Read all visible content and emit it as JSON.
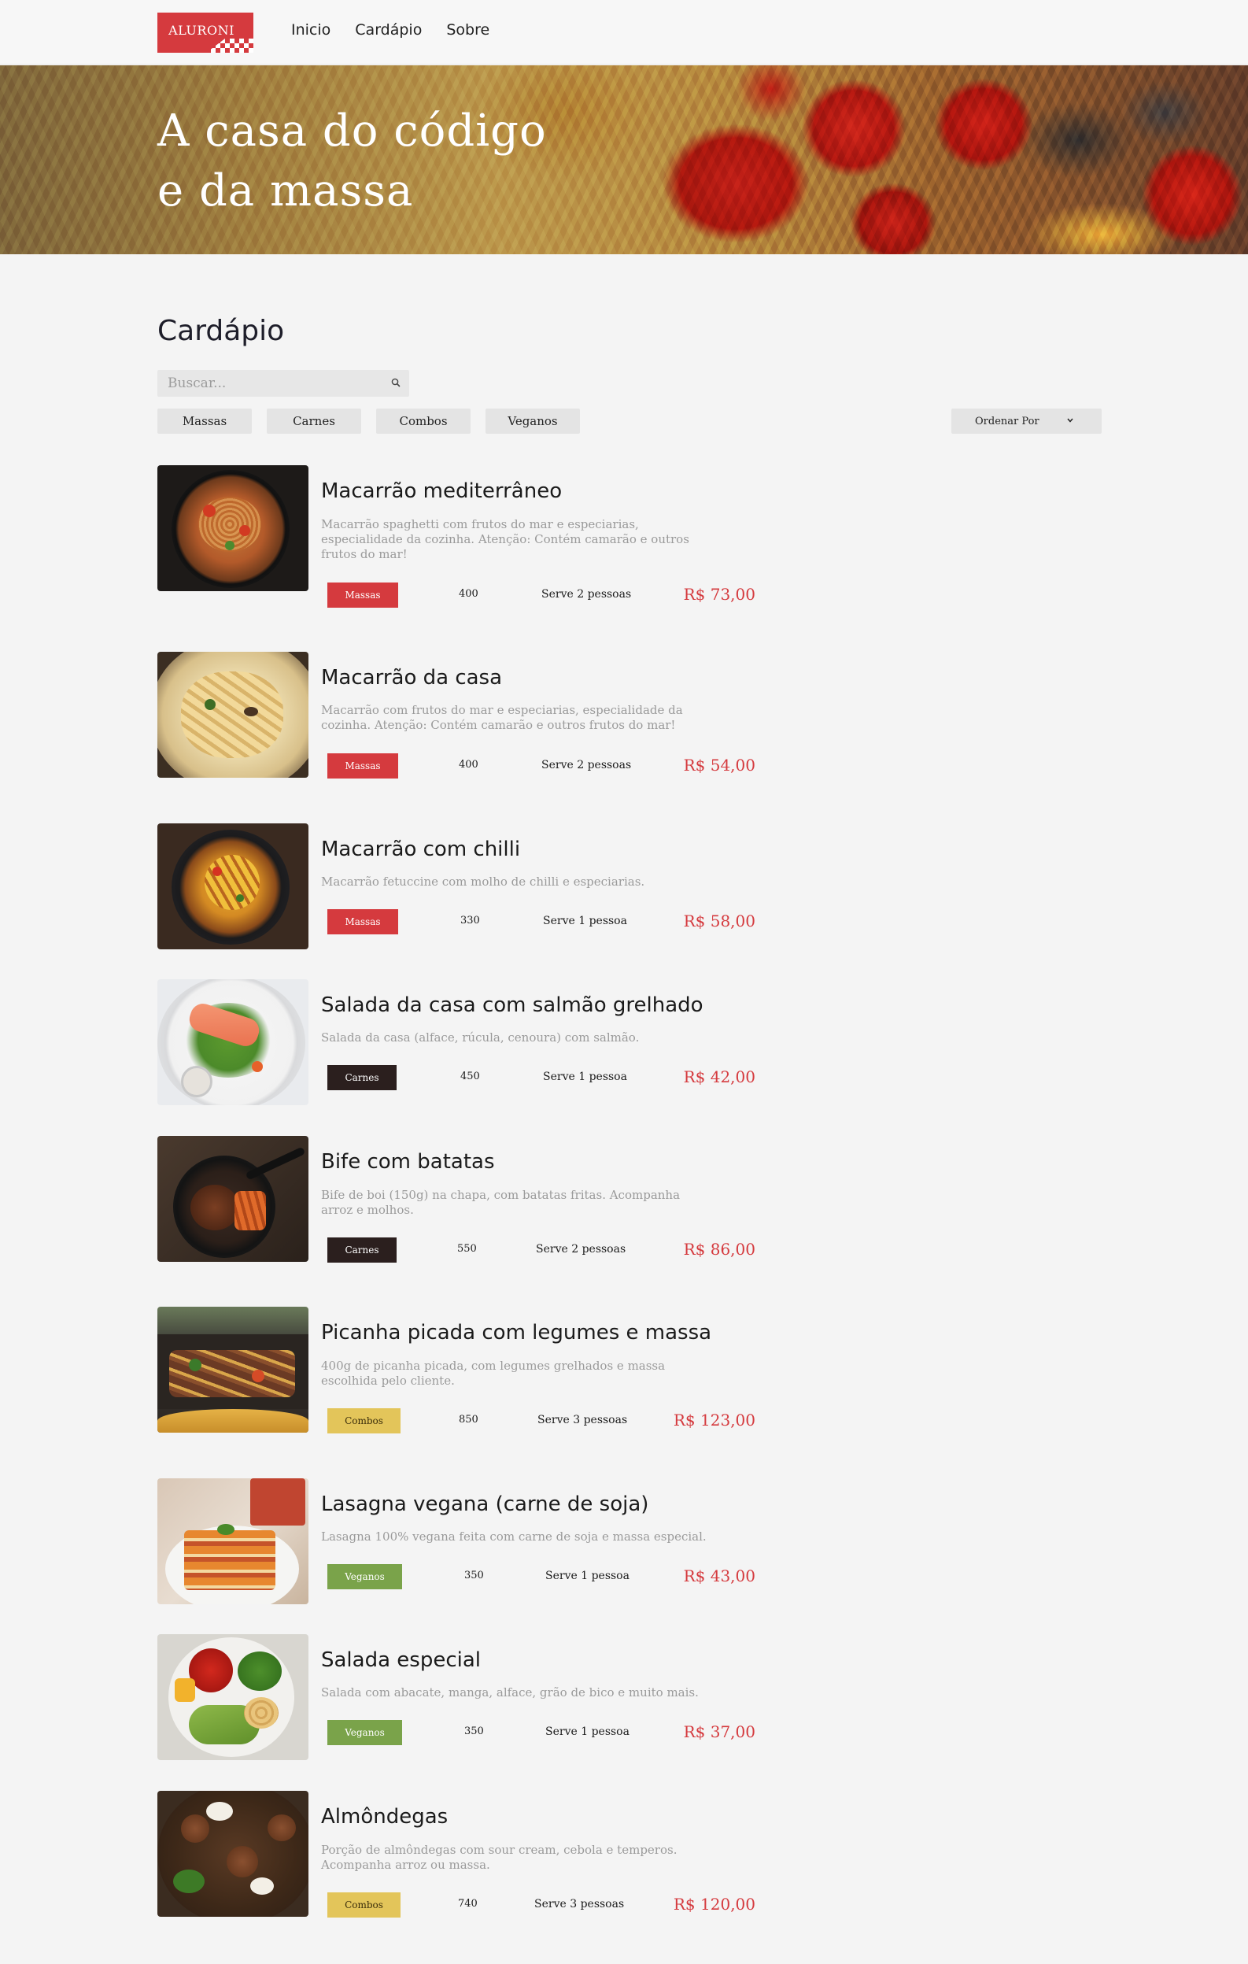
{
  "header": {
    "logo_text": "ALURONI",
    "nav": [
      "Inicio",
      "Cardápio",
      "Sobre"
    ]
  },
  "hero": {
    "title_line1": "A casa do código",
    "title_line2": "e da massa"
  },
  "menu": {
    "title": "Cardápio",
    "search_placeholder": "Buscar...",
    "filters": [
      "Massas",
      "Carnes",
      "Combos",
      "Veganos"
    ],
    "sort_label": "Ordenar Por",
    "items": [
      {
        "name": "Macarrão mediterrâneo",
        "description": "Macarrão spaghetti com frutos do mar e especiarias, especialidade da cozinha. Atenção: Contém camarão e outros frutos do mar!",
        "category": "Massas",
        "size": "400",
        "serves": "Serve 2 pessoas",
        "price": "R$ 73,00"
      },
      {
        "name": "Macarrão da casa",
        "description": "Macarrão com frutos do mar e especiarias, especialidade da cozinha. Atenção: Contém camarão e outros frutos do mar!",
        "category": "Massas",
        "size": "400",
        "serves": "Serve 2 pessoas",
        "price": "R$ 54,00"
      },
      {
        "name": "Macarrão com chilli",
        "description": "Macarrão fetuccine com molho de chilli e especiarias.",
        "category": "Massas",
        "size": "330",
        "serves": "Serve 1 pessoa",
        "price": "R$ 58,00"
      },
      {
        "name": "Salada da casa com salmão grelhado",
        "description": "Salada da casa (alface, rúcula, cenoura) com salmão.",
        "category": "Carnes",
        "size": "450",
        "serves": "Serve 1 pessoa",
        "price": "R$ 42,00"
      },
      {
        "name": "Bife com batatas",
        "description": "Bife de boi (150g) na chapa, com batatas fritas. Acompanha arroz e molhos.",
        "category": "Carnes",
        "size": "550",
        "serves": "Serve 2 pessoas",
        "price": "R$ 86,00"
      },
      {
        "name": "Picanha picada com legumes e massa",
        "description": "400g de picanha picada, com legumes grelhados e massa escolhida pelo cliente.",
        "category": "Combos",
        "size": "850",
        "serves": "Serve 3 pessoas",
        "price": "R$ 123,00"
      },
      {
        "name": "Lasagna vegana (carne de soja)",
        "description": "Lasagna 100% vegana feita com carne de soja e massa especial.",
        "category": "Veganos",
        "size": "350",
        "serves": "Serve 1 pessoa",
        "price": "R$ 43,00"
      },
      {
        "name": "Salada especial",
        "description": "Salada com abacate, manga, alface, grão de bico e muito mais.",
        "category": "Veganos",
        "size": "350",
        "serves": "Serve 1 pessoa",
        "price": "R$ 37,00"
      },
      {
        "name": "Almôndegas",
        "description": "Porção de almôndegas com sour cream, cebola e temperos. Acompanha arroz ou massa.",
        "category": "Combos",
        "size": "740",
        "serves": "Serve 3 pessoas",
        "price": "R$ 120,00"
      }
    ]
  },
  "colors": {
    "accent": "#d53a3e",
    "carnes": "#2b1f1e",
    "combos": "#e3c55a",
    "veganos": "#7aa34a"
  },
  "icons": [
    "search-icon",
    "chevron-down-icon"
  ]
}
